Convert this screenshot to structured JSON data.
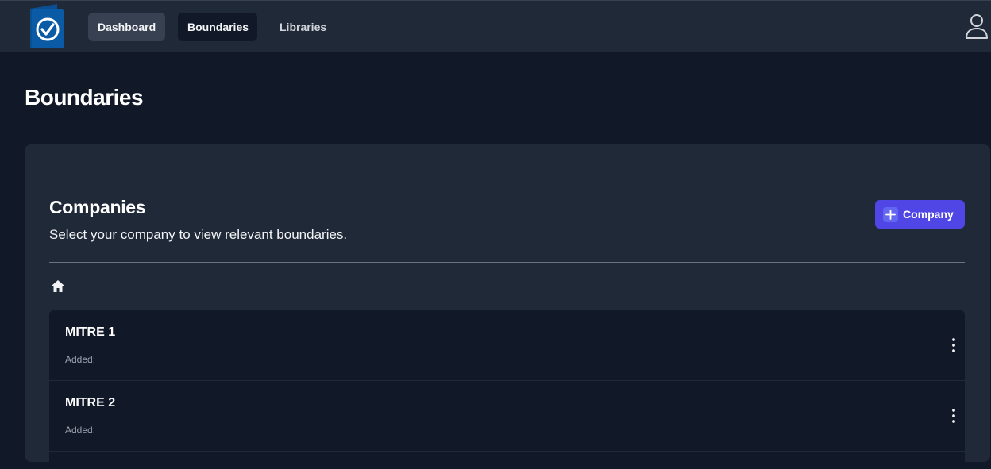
{
  "nav": {
    "items": [
      {
        "label": "Dashboard"
      },
      {
        "label": "Boundaries"
      },
      {
        "label": "Libraries"
      }
    ],
    "logo_icon": "checkmark-book-logo",
    "user_icon": "user-icon"
  },
  "page": {
    "title": "Boundaries"
  },
  "companies": {
    "title": "Companies",
    "description": "Select your company to view relevant boundaries.",
    "add_button_label": "Company",
    "breadcrumb_icon": "home-icon",
    "items": [
      {
        "name": "MITRE 1",
        "added_label": "Added:"
      },
      {
        "name": "MITRE 2",
        "added_label": "Added:"
      }
    ]
  },
  "colors": {
    "accent": "#4f46e5",
    "background": "#111827",
    "panel": "#1f2937",
    "logo_blue": "#0b5aa6"
  }
}
